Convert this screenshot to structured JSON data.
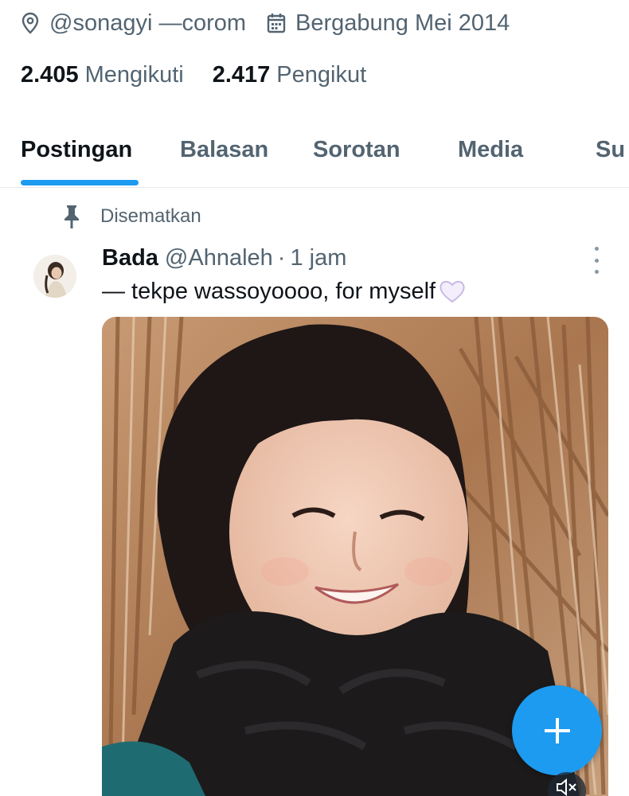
{
  "profile": {
    "location": "@sonagyi —corom",
    "joined": "Bergabung Mei 2014",
    "following_count": "2.405",
    "following_label": "Mengikuti",
    "followers_count": "2.417",
    "followers_label": "Pengikut",
    "icons": {
      "location": "location-pin-icon",
      "calendar": "calendar-icon"
    }
  },
  "tabs": [
    {
      "label": "Postingan",
      "active": true
    },
    {
      "label": "Balasan",
      "active": false
    },
    {
      "label": "Sorotan",
      "active": false
    },
    {
      "label": "Media",
      "active": false
    },
    {
      "label": "Su",
      "active": false
    }
  ],
  "tweet": {
    "pinned_label": "Disematkan",
    "author": "Bada",
    "handle": "@Ahnaleh",
    "separator": "·",
    "time": "1 jam",
    "text": "— tekpe wassoyoooo, for myself",
    "emoji": "white-heart-emoji",
    "media": "photo of a smiling person in a dark scarf in front of dry reeds"
  },
  "fab": {
    "icon": "plus-icon"
  },
  "video": {
    "icon": "muted-speaker-icon"
  },
  "colors": {
    "accent": "#1d9bf0",
    "text_primary": "#0f1419",
    "text_secondary": "#536471"
  }
}
